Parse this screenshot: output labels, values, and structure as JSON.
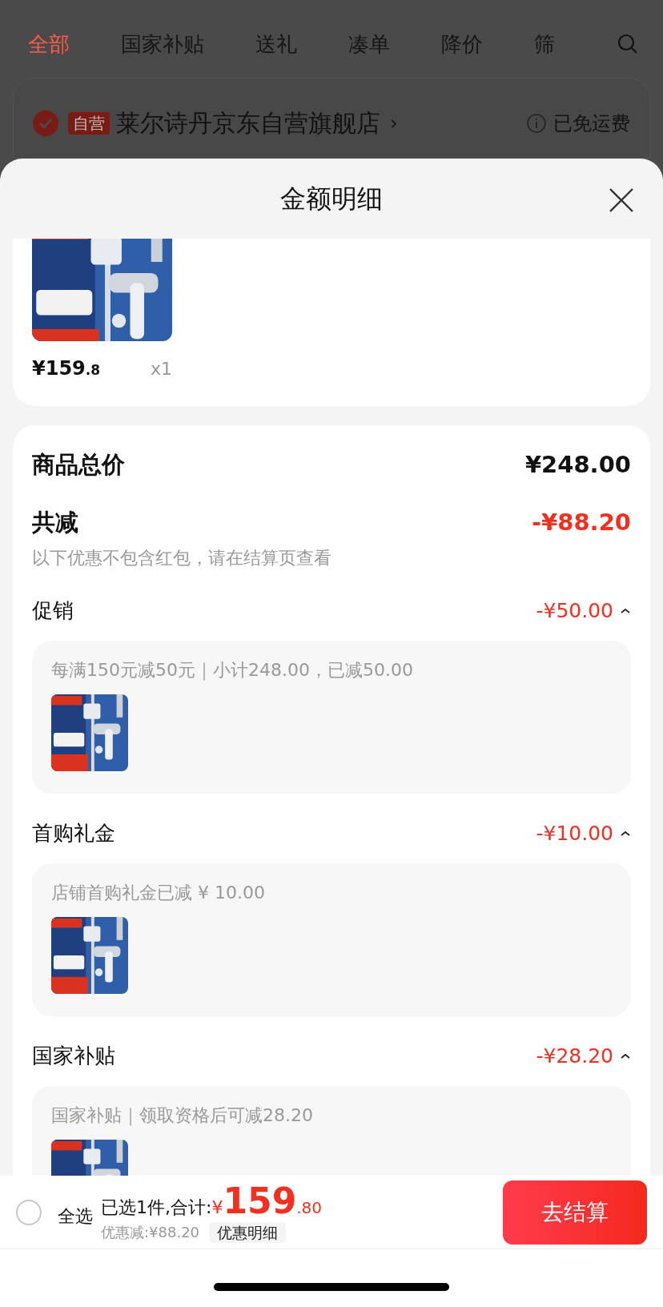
{
  "tabs": [
    {
      "label": "全部",
      "selected": true
    },
    {
      "label": "国家补贴",
      "selected": false
    },
    {
      "label": "送礼",
      "selected": false
    },
    {
      "label": "凑单",
      "selected": false
    },
    {
      "label": "降价",
      "selected": false
    },
    {
      "label": "筛",
      "selected": false
    }
  ],
  "store": {
    "checked": true,
    "badge": "自营",
    "name": "莱尔诗丹京东自营旗舰店",
    "chevron": "›",
    "shipping": "已免运费"
  },
  "sheet": {
    "title": "金额明细",
    "product": {
      "price_integer": "¥159",
      "price_decimal": ".8",
      "quantity": "x1"
    },
    "summary": {
      "total_label": "商品总价",
      "total_value": "¥248.00",
      "discount_label": "共减",
      "discount_value": "-¥88.20",
      "note": "以下优惠不包含红包，请在结算页查看"
    },
    "sections": [
      {
        "title": "促销",
        "amount": "-¥50.00",
        "expanded": true,
        "detail": "每满150元减50元｜小计248.00，已减50.00"
      },
      {
        "title": "首购礼金",
        "amount": "-¥10.00",
        "expanded": true,
        "detail": "店铺首购礼金已减 ¥ 10.00"
      },
      {
        "title": "国家补贴",
        "amount": "-¥28.20",
        "expanded": true,
        "detail": "国家补贴｜领取资格后可减28.20"
      }
    ]
  },
  "checkout": {
    "select_all": {
      "label": "全选",
      "checked": false
    },
    "selected_text": "已选1件,合计:",
    "currency": "¥",
    "total_integer": "159",
    "total_decimal": ".80",
    "discount_text": "优惠减:¥88.20",
    "detail_link": "优惠明细",
    "button": "去结算"
  }
}
